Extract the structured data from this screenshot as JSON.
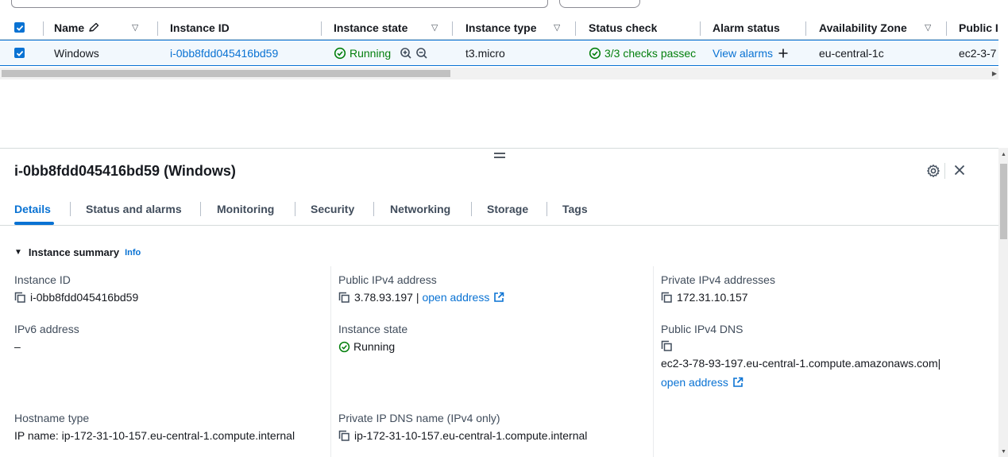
{
  "table": {
    "columns": [
      {
        "label": "Name",
        "has_edit_icon": true,
        "has_filter": true
      },
      {
        "label": "Instance ID",
        "has_filter": false
      },
      {
        "label": "Instance state",
        "has_filter": true
      },
      {
        "label": "Instance type",
        "has_filter": true
      },
      {
        "label": "Status check",
        "has_filter": false
      },
      {
        "label": "Alarm status",
        "has_filter": false
      },
      {
        "label": "Availability Zone",
        "has_filter": true
      },
      {
        "label": "Public I",
        "has_filter": false
      }
    ],
    "row": {
      "selected": true,
      "name": "Windows",
      "instance_id": "i-0bb8fdd045416bd59",
      "state": "Running",
      "type": "t3.micro",
      "status_check": "3/3 checks passec",
      "alarm_link": "View alarms",
      "az": "eu-central-1c",
      "public_dns_trunc": "ec2-3-7"
    }
  },
  "panel": {
    "title": "i-0bb8fdd045416bd59 (Windows)",
    "tabs": [
      "Details",
      "Status and alarms",
      "Monitoring",
      "Security",
      "Networking",
      "Storage",
      "Tags"
    ],
    "active_tab": "Details",
    "section_title": "Instance summary",
    "section_info": "Info",
    "fields": {
      "instance_id_label": "Instance ID",
      "instance_id_value": "i-0bb8fdd045416bd59",
      "public_ipv4_label": "Public IPv4 address",
      "public_ipv4_value": "3.78.93.197 |",
      "public_ipv4_link": "open address",
      "private_ipv4_label": "Private IPv4 addresses",
      "private_ipv4_value": "172.31.10.157",
      "ipv6_label": "IPv6 address",
      "ipv6_value": "–",
      "instance_state_label": "Instance state",
      "instance_state_value": "Running",
      "public_dns_label": "Public IPv4 DNS",
      "public_dns_value": "ec2-3-78-93-197.eu-central-1.compute.amazonaws.com|",
      "public_dns_link": "open address",
      "hostname_type_label": "Hostname type",
      "hostname_type_value": "IP name: ip-172-31-10-157.eu-central-1.compute.internal",
      "private_dns_label": "Private IP DNS name (IPv4 only)",
      "private_dns_value": "ip-172-31-10-157.eu-central-1.compute.internal"
    }
  },
  "colors": {
    "link": "#0972d3",
    "success": "#037f0c",
    "selected_row_bg": "#f2f8fd",
    "checkbox": "#0972d3"
  }
}
